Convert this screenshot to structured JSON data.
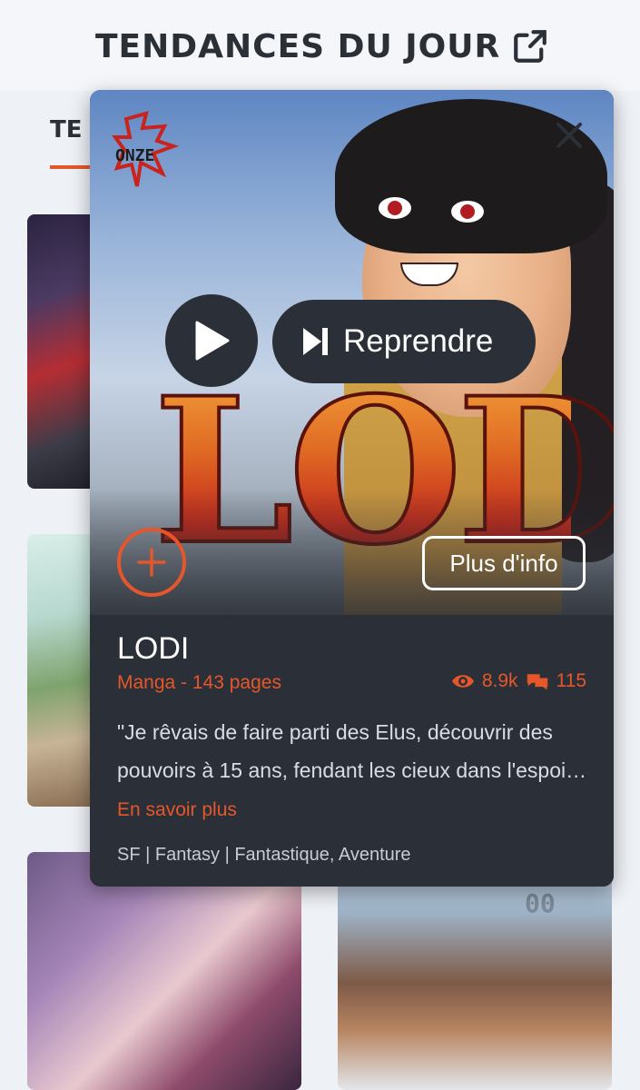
{
  "header": {
    "title": "TENDANCES DU JOUR",
    "tab_fragment": "TE"
  },
  "background_cards": {
    "card4_number": "00"
  },
  "popup": {
    "cover": {
      "logo_text": "LODI",
      "publisher_logo_text": "ONZE"
    },
    "resume_label": "Reprendre",
    "more_info_label": "Plus d'info",
    "title": "LODI",
    "meta": "Manga - 143 pages",
    "views": "8.9k",
    "comments": "115",
    "description": "\"Je rêvais de faire parti des Elus, découvrir des pouvoirs à 15 ans, fendant les cieux dans l'espoi…",
    "read_more": "En savoir plus",
    "genres": "SF | Fantasy | Fantastique, Aventure"
  },
  "colors": {
    "accent": "#e5572a",
    "popup_bg": "#2b3038",
    "page_bg": "#eef1f6"
  },
  "icons": [
    "external-link-icon",
    "close-icon",
    "play-icon",
    "skip-next-icon",
    "plus-icon",
    "eye-icon",
    "comments-icon"
  ]
}
